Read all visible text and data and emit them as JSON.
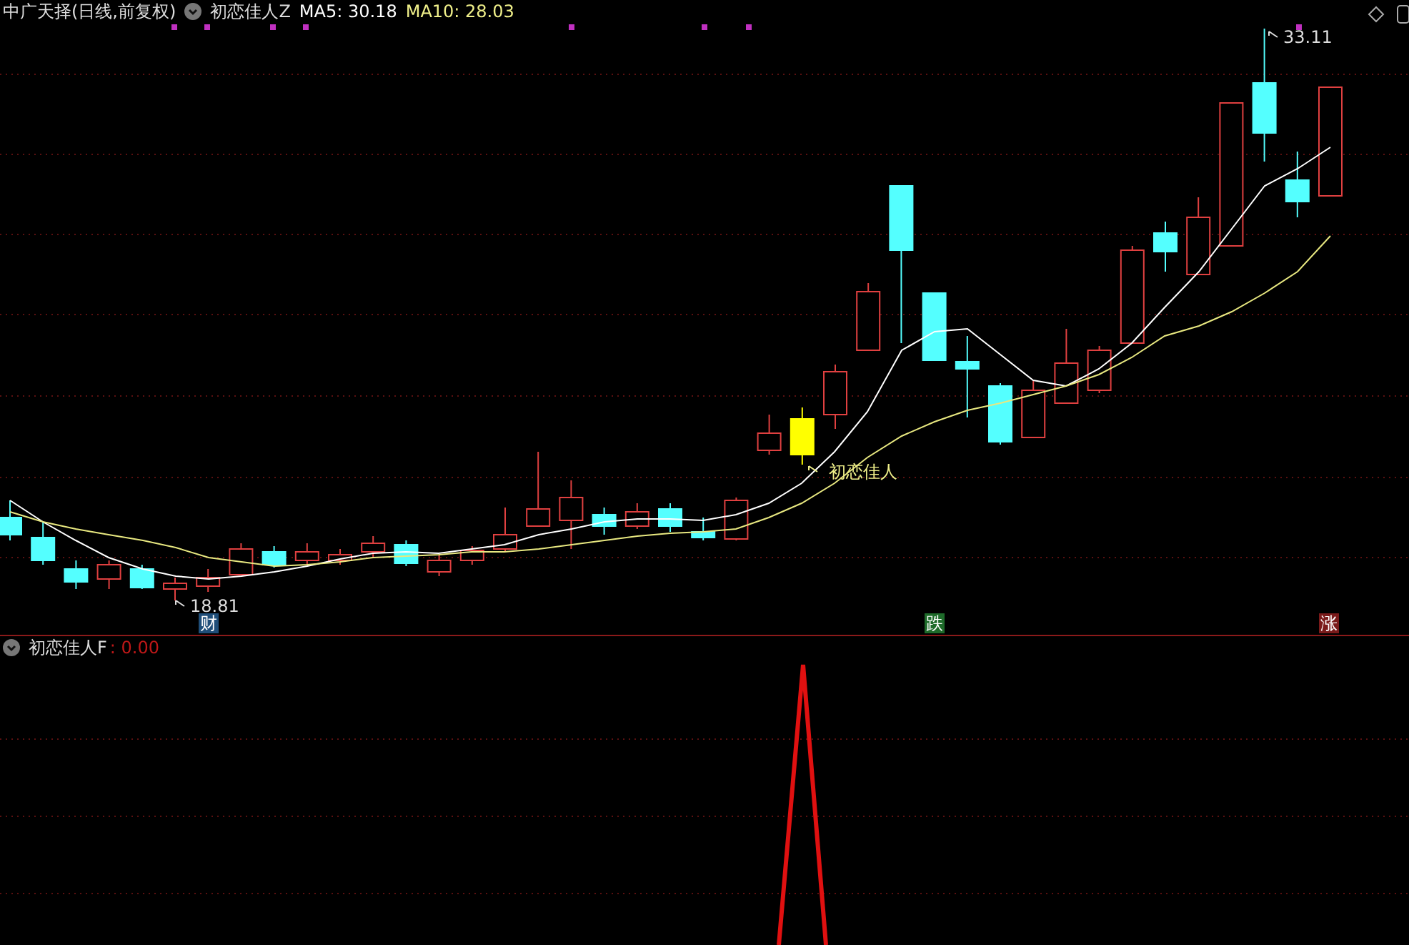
{
  "main_panel": {
    "title": "中广天择(日线,前复权)",
    "indicator_name": "初恋佳人Z",
    "ma5": "MA5: 30.18",
    "ma10": "MA10: 28.03",
    "annotations": [
      {
        "kind": "high",
        "text": "33.11"
      },
      {
        "kind": "low",
        "text": "18.81"
      },
      {
        "kind": "signal",
        "text": "初恋佳人"
      }
    ],
    "markers": [
      {
        "text": "财",
        "color": "#1f4e79"
      },
      {
        "text": "跌",
        "color": "#1e6b2a"
      },
      {
        "text": "涨",
        "color": "#7a1a1a"
      }
    ]
  },
  "sub_panel": {
    "indicator_name": "初恋佳人F",
    "value": ": 0.00"
  }
}
